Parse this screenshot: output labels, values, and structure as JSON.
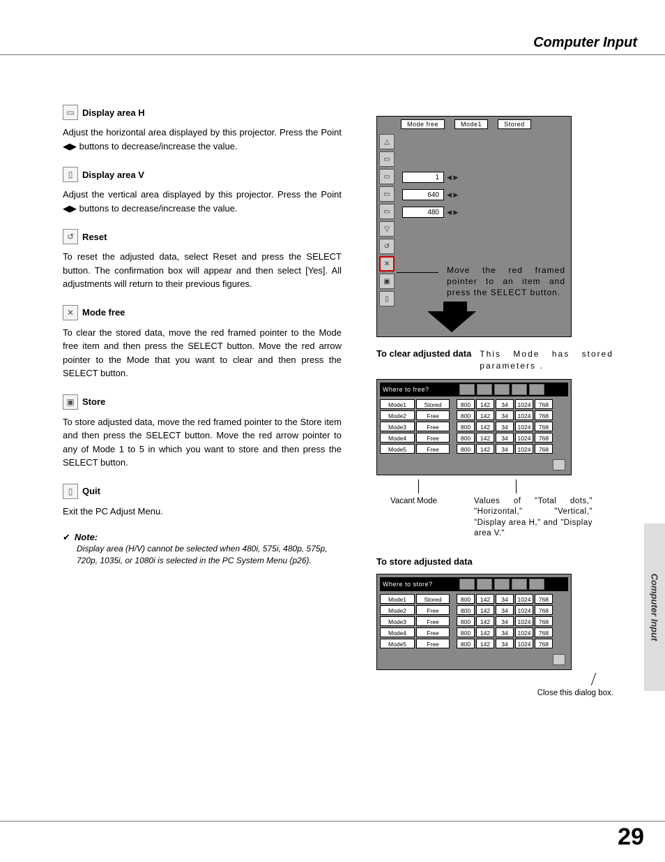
{
  "header": {
    "title": "Computer Input"
  },
  "sections": [
    {
      "title": "Display area H",
      "body": "Adjust the horizontal area displayed by this projector.  Press the Point ◀▶ buttons to decrease/increase the value."
    },
    {
      "title": "Display area V",
      "body": "Adjust the vertical area displayed by this projector.  Press the Point ◀▶ buttons to decrease/increase the value."
    },
    {
      "title": "Reset",
      "body": "To reset the adjusted data, select Reset and press the SELECT button.  The confirmation box will appear and then select [Yes].  All adjustments will return to their previous figures."
    },
    {
      "title": "Mode free",
      "body": "To clear the stored data, move the red framed pointer to the Mode free item and then press the SELECT button.  Move the red arrow pointer to the Mode that you want to clear and then press the SELECT button."
    },
    {
      "title": "Store",
      "body": "To store adjusted data, move the red framed pointer to the Store item and then press the SELECT button.  Move the red arrow pointer to any of Mode 1 to 5 in which you want to store and then press the SELECT button."
    },
    {
      "title": "Quit",
      "body": "Exit the PC Adjust Menu."
    }
  ],
  "note": {
    "label": "Note:",
    "body": "Display area (H/V) cannot be selected when 480i, 575i, 480p, 575p, 720p, 1035i, or 1080i is selected in the PC System Menu (p26)."
  },
  "menu": {
    "tabs": [
      "Mode free",
      "Mode1",
      "Stored"
    ],
    "rows": [
      {
        "value": "1"
      },
      {
        "value": "640"
      },
      {
        "value": "480"
      }
    ],
    "hint": "Move the red framed pointer to an item and press the SELECT button."
  },
  "clear": {
    "heading": "To clear adjusted data",
    "side_note": "This Mode has stored parameters .",
    "table_title": "Where to free?",
    "callout_left": "Vacant Mode",
    "callout_right": "Values of \"Total dots,\" \"Horizontal,\" \"Vertical,\" \"Display area H,\" and \"Display area V.\""
  },
  "store": {
    "heading": "To store adjusted data",
    "table_title": "Where to store?",
    "callout": "Close this dialog box."
  },
  "tables": {
    "columns": [
      "mode",
      "status",
      "c1",
      "c2",
      "c3",
      "c4",
      "c5"
    ],
    "rows": [
      [
        "Mode1",
        "Stored",
        "800",
        "142",
        "34",
        "1024",
        "768"
      ],
      [
        "Mode2",
        "Free",
        "800",
        "142",
        "34",
        "1024",
        "768"
      ],
      [
        "Mode3",
        "Free",
        "800",
        "142",
        "34",
        "1024",
        "768"
      ],
      [
        "Mode4",
        "Free",
        "800",
        "142",
        "34",
        "1024",
        "768"
      ],
      [
        "Mode5",
        "Free",
        "800",
        "142",
        "34",
        "1024",
        "768"
      ]
    ],
    "selected_row": 1
  },
  "side_tab": {
    "label": "Computer Input"
  },
  "page_number": "29"
}
